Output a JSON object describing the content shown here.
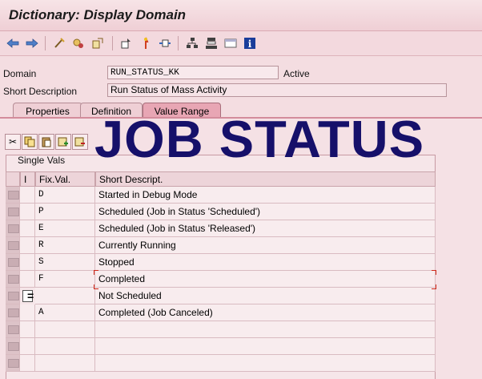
{
  "window": {
    "title": "Dictionary: Display Domain"
  },
  "toolbar": {
    "icons": [
      "back-arrow-icon",
      "forward-arrow-icon",
      "other-object-icon",
      "display-change-icon",
      "check-icon",
      "activate-icon",
      "where-used-icon",
      "navigate-icon",
      "object-list-icon",
      "hierarchy-icon",
      "table-icon",
      "info-icon"
    ]
  },
  "header": {
    "domain_label": "Domain",
    "domain_value": "RUN_STATUS_KK",
    "domain_status": "Active",
    "short_desc_label": "Short Description",
    "short_desc_value": "Run Status of Mass Activity"
  },
  "tabs": [
    {
      "label": "Properties",
      "active": false
    },
    {
      "label": "Definition",
      "active": false
    },
    {
      "label": "Value Range",
      "active": true
    }
  ],
  "panel": {
    "section_title": "Single Vals",
    "columns": {
      "indicator": "I",
      "fixval": "Fix.Val.",
      "desc": "Short Descript."
    },
    "rows": [
      {
        "fixval": "D",
        "desc": "Started in Debug Mode"
      },
      {
        "fixval": "P",
        "desc": "Scheduled (Job in Status 'Scheduled')"
      },
      {
        "fixval": "E",
        "desc": "Scheduled (Job in Status 'Released')"
      },
      {
        "fixval": "R",
        "desc": "Currently Running"
      },
      {
        "fixval": "S",
        "desc": "Stopped"
      },
      {
        "fixval": "F",
        "desc": "Completed"
      },
      {
        "fixval": "",
        "desc": "Not Scheduled"
      },
      {
        "fixval": "A",
        "desc": "Completed (Job Canceled)"
      }
    ],
    "equal_indicator": "="
  },
  "overlay_text": "JOB STATUS",
  "colors": {
    "overlay": "#16106a",
    "active_tab": "#e8a6b4",
    "background": "#f4dde1"
  }
}
